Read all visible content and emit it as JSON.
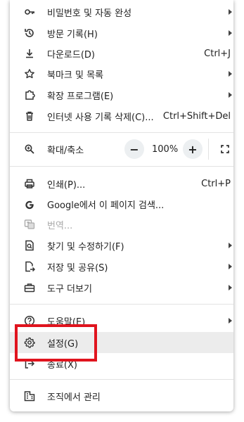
{
  "menu": {
    "items": [
      {
        "name": "password-autofill-item",
        "label": "비밀번호 및 자동 완성",
        "shortcut": "",
        "submenu": true,
        "icon": "key-icon"
      },
      {
        "name": "history-item",
        "label": "방문 기록(H)",
        "shortcut": "",
        "submenu": true,
        "icon": "history-icon"
      },
      {
        "name": "downloads-item",
        "label": "다운로드(D)",
        "shortcut": "Ctrl+J",
        "submenu": false,
        "icon": "download-icon"
      },
      {
        "name": "bookmarks-item",
        "label": "북마크 및 목록",
        "shortcut": "",
        "submenu": true,
        "icon": "star-icon"
      },
      {
        "name": "extensions-item",
        "label": "확장 프로그램(E)",
        "shortcut": "",
        "submenu": true,
        "icon": "puzzle-icon"
      },
      {
        "name": "clear-browsing-data-item",
        "label": "인터넷 사용 기록 삭제(C)...",
        "shortcut": "Ctrl+Shift+Del",
        "submenu": false,
        "icon": "trash-icon"
      },
      {
        "name": "print-item",
        "label": "인쇄(P)...",
        "shortcut": "Ctrl+P",
        "submenu": false,
        "icon": "printer-icon"
      },
      {
        "name": "google-search-page-item",
        "label": "Google에서 이 페이지 검색...",
        "shortcut": "",
        "submenu": false,
        "icon": "google-icon"
      },
      {
        "name": "translate-item",
        "label": "번역...",
        "shortcut": "",
        "submenu": false,
        "icon": "translate-icon"
      },
      {
        "name": "find-edit-item",
        "label": "찾기 및 수정하기(F)",
        "shortcut": "",
        "submenu": true,
        "icon": "find-icon"
      },
      {
        "name": "save-share-item",
        "label": "저장 및 공유(S)",
        "shortcut": "",
        "submenu": true,
        "icon": "save-share-icon"
      },
      {
        "name": "more-tools-item",
        "label": "도구 더보기",
        "shortcut": "",
        "submenu": true,
        "icon": "toolbox-icon"
      },
      {
        "name": "help-item",
        "label": "도움말(E)",
        "shortcut": "",
        "submenu": true,
        "icon": "help-icon"
      },
      {
        "name": "settings-item",
        "label": "설정(G)",
        "shortcut": "",
        "submenu": false,
        "icon": "gear-icon"
      },
      {
        "name": "exit-item",
        "label": "종료(X)",
        "shortcut": "",
        "submenu": false,
        "icon": "exit-icon"
      },
      {
        "name": "managed-by-org-item",
        "label": "조직에서 관리",
        "shortcut": "",
        "submenu": false,
        "icon": "building-icon"
      }
    ],
    "zoom": {
      "label": "확대/축소",
      "value": "100%",
      "minus": "−",
      "plus": "+"
    }
  },
  "highlight_color": "#e0141e"
}
